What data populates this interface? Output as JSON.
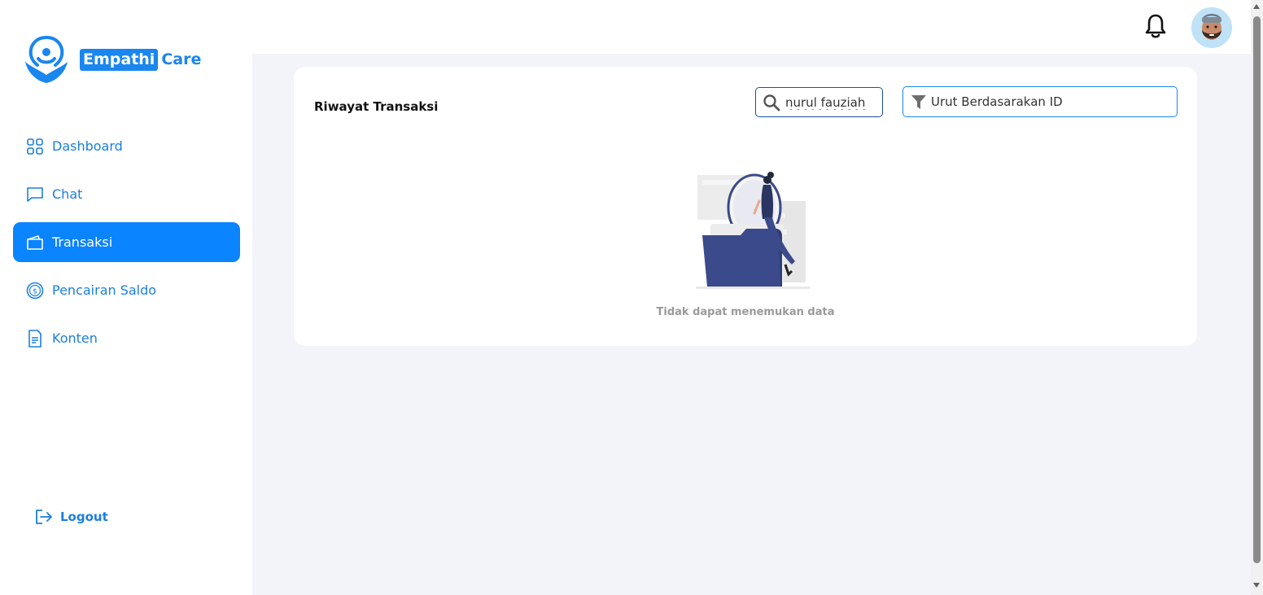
{
  "brand": {
    "word1": "Empathi",
    "word2": "Care",
    "color": "#1a86f0"
  },
  "sidebar": {
    "items": [
      {
        "label": "Dashboard",
        "icon": "grid-icon",
        "active": false
      },
      {
        "label": "Chat",
        "icon": "chat-bubble-icon",
        "active": false
      },
      {
        "label": "Transaksi",
        "icon": "wallet-icon",
        "active": true
      },
      {
        "label": "Pencairan Saldo",
        "icon": "dollar-coin-icon",
        "active": false
      },
      {
        "label": "Konten",
        "icon": "document-icon",
        "active": false
      }
    ],
    "logout_label": "Logout"
  },
  "topbar": {
    "notification_icon": "bell-icon",
    "avatar_icon": "user-avatar"
  },
  "main": {
    "title": "Riwayat Transaksi",
    "search": {
      "value": "nurul fauziah",
      "icon": "search-icon"
    },
    "sort": {
      "label": "Urut Berdasarakan ID",
      "icon": "filter-icon"
    },
    "empty_text": "Tidak dapat menemukan data"
  },
  "colors": {
    "accent": "#0a84ff",
    "background": "#f3f4f9",
    "folder": "#3b4a8a"
  }
}
